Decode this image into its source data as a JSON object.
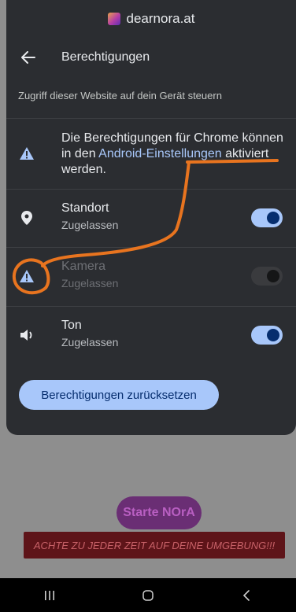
{
  "site": {
    "url": "dearnora.at",
    "icon": "site-favicon-icon"
  },
  "header": {
    "title": "Berechtigungen",
    "back_icon": "arrow-back-icon"
  },
  "description": "Zugriff dieser Website auf dein Gerät steuern",
  "notice": {
    "text_before": "Die Berechtigungen für Chrome können in den ",
    "link": "Android-Einstellungen",
    "text_after": " aktiviert werden.",
    "icon": "warning-icon"
  },
  "permissions": [
    {
      "name": "Standort",
      "status": "Zugelassen",
      "icon": "location-pin-icon",
      "toggle": true,
      "enabled": true
    },
    {
      "name": "Kamera",
      "status": "Zugelassen",
      "icon": "warning-icon",
      "toggle": false,
      "enabled": false
    },
    {
      "name": "Ton",
      "status": "Zugelassen",
      "icon": "speaker-icon",
      "toggle": true,
      "enabled": true
    }
  ],
  "reset_label": "Berechtigungen zurücksetzen",
  "background_page": {
    "start_button": "Starte NOrA",
    "warning_banner": "ACHTE ZU JEDER ZEIT AUF DEINE UMGEBUNG!!!"
  },
  "nav": [
    "recents-icon",
    "home-icon",
    "back-icon"
  ],
  "colors": {
    "sheet": "#2b2d31",
    "accent": "#a8c7fa",
    "annotation": "#e8741f",
    "banner": "#5e1419"
  }
}
